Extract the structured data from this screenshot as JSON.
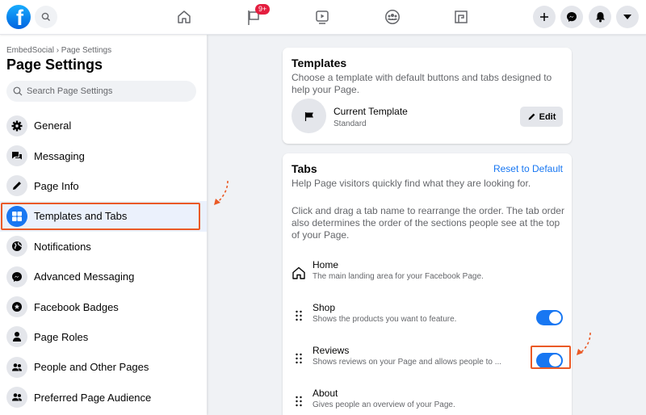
{
  "topbar": {
    "logo_letter": "f",
    "notification_badge": "9+",
    "nav_icons": [
      "home-icon",
      "flag-icon",
      "watch-icon",
      "groups-icon",
      "gaming-icon"
    ],
    "right_buttons": [
      "plus-icon",
      "messenger-icon",
      "bell-icon",
      "caret-down-icon"
    ]
  },
  "sidebar": {
    "breadcrumb": "EmbedSocial › Page Settings",
    "title": "Page Settings",
    "search_placeholder": "Search Page Settings",
    "items": [
      {
        "label": "General",
        "icon": "gear-icon"
      },
      {
        "label": "Messaging",
        "icon": "chat-bubbles-icon"
      },
      {
        "label": "Page Info",
        "icon": "pencil-icon"
      },
      {
        "label": "Templates and Tabs",
        "icon": "grid-icon",
        "active": true
      },
      {
        "label": "Notifications",
        "icon": "globe-icon"
      },
      {
        "label": "Advanced Messaging",
        "icon": "messenger-icon"
      },
      {
        "label": "Facebook Badges",
        "icon": "star-badge-icon"
      },
      {
        "label": "Page Roles",
        "icon": "person-icon"
      },
      {
        "label": "People and Other Pages",
        "icon": "people-icon"
      },
      {
        "label": "Preferred Page Audience",
        "icon": "people-icon"
      }
    ]
  },
  "templates_card": {
    "title": "Templates",
    "description": "Choose a template with default buttons and tabs designed to help your Page.",
    "current_label": "Current Template",
    "current_value": "Standard",
    "edit_label": "Edit"
  },
  "tabs_card": {
    "title": "Tabs",
    "reset_label": "Reset to Default",
    "description": "Help Page visitors quickly find what they are looking for.",
    "instructions": "Click and drag a tab name to rearrange the order. The tab order also determines the order of the sections people see at the top of your Page.",
    "tabs": [
      {
        "name": "Home",
        "description": "The main landing area for your Facebook Page.",
        "icon": "home-icon",
        "toggle": null
      },
      {
        "name": "Shop",
        "description": "Shows the products you want to feature.",
        "icon": "drag-handle-icon",
        "toggle": true
      },
      {
        "name": "Reviews",
        "description": "Shows reviews on your Page and allows people to ...",
        "icon": "drag-handle-icon",
        "toggle": true
      },
      {
        "name": "About",
        "description": "Gives people an overview of your Page.",
        "icon": "drag-handle-icon",
        "toggle": null
      }
    ]
  },
  "colors": {
    "accent": "#1877f2",
    "annotation": "#ea5a26",
    "badge": "#e41e3f"
  }
}
